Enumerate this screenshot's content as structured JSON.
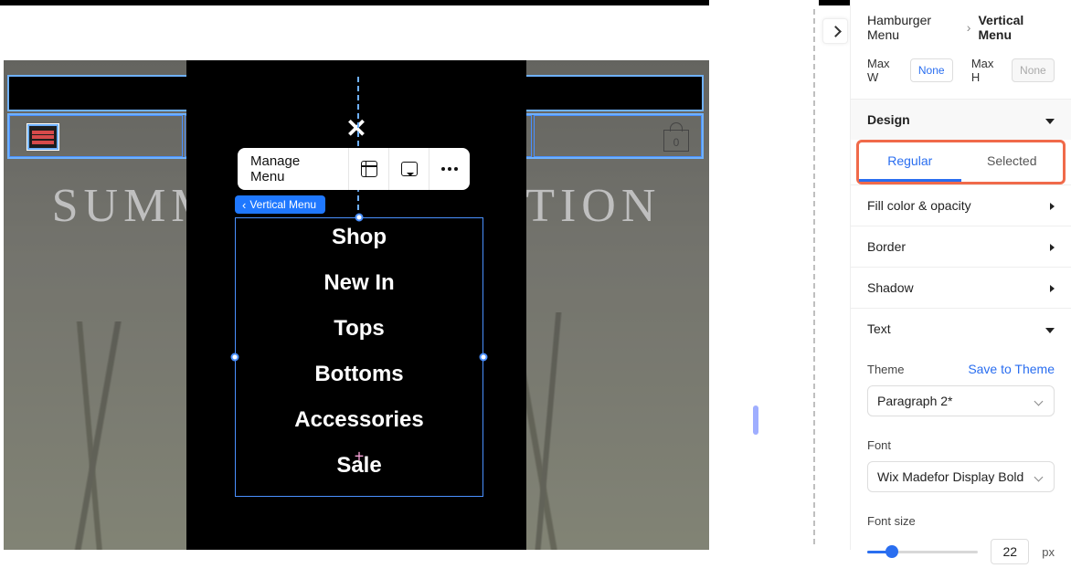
{
  "stage": {
    "hero": "SUMMER COLLECTION",
    "bag_count": "0",
    "menu_panel": {
      "items": [
        "Shop",
        "New In",
        "Tops",
        "Bottoms",
        "Accessories",
        "Sale"
      ]
    },
    "toolbar": {
      "manage_label": "Manage Menu"
    },
    "tag_label": "Vertical Menu"
  },
  "panel": {
    "breadcrumb": {
      "parent": "Hamburger Menu",
      "current": "Vertical Menu"
    },
    "maxw": {
      "label": "Max W",
      "value": "None"
    },
    "maxh": {
      "label": "Max H",
      "value": "None"
    },
    "design_label": "Design",
    "tabs": {
      "regular": "Regular",
      "selected": "Selected"
    },
    "props": {
      "fill": "Fill color & opacity",
      "border": "Border",
      "shadow": "Shadow",
      "text": "Text"
    },
    "theme": {
      "label": "Theme",
      "save": "Save to Theme",
      "value": "Paragraph 2*"
    },
    "font": {
      "label": "Font",
      "value": "Wix Madefor Display Bold"
    },
    "fontsize": {
      "label": "Font size",
      "value": "22",
      "unit": "px"
    }
  }
}
